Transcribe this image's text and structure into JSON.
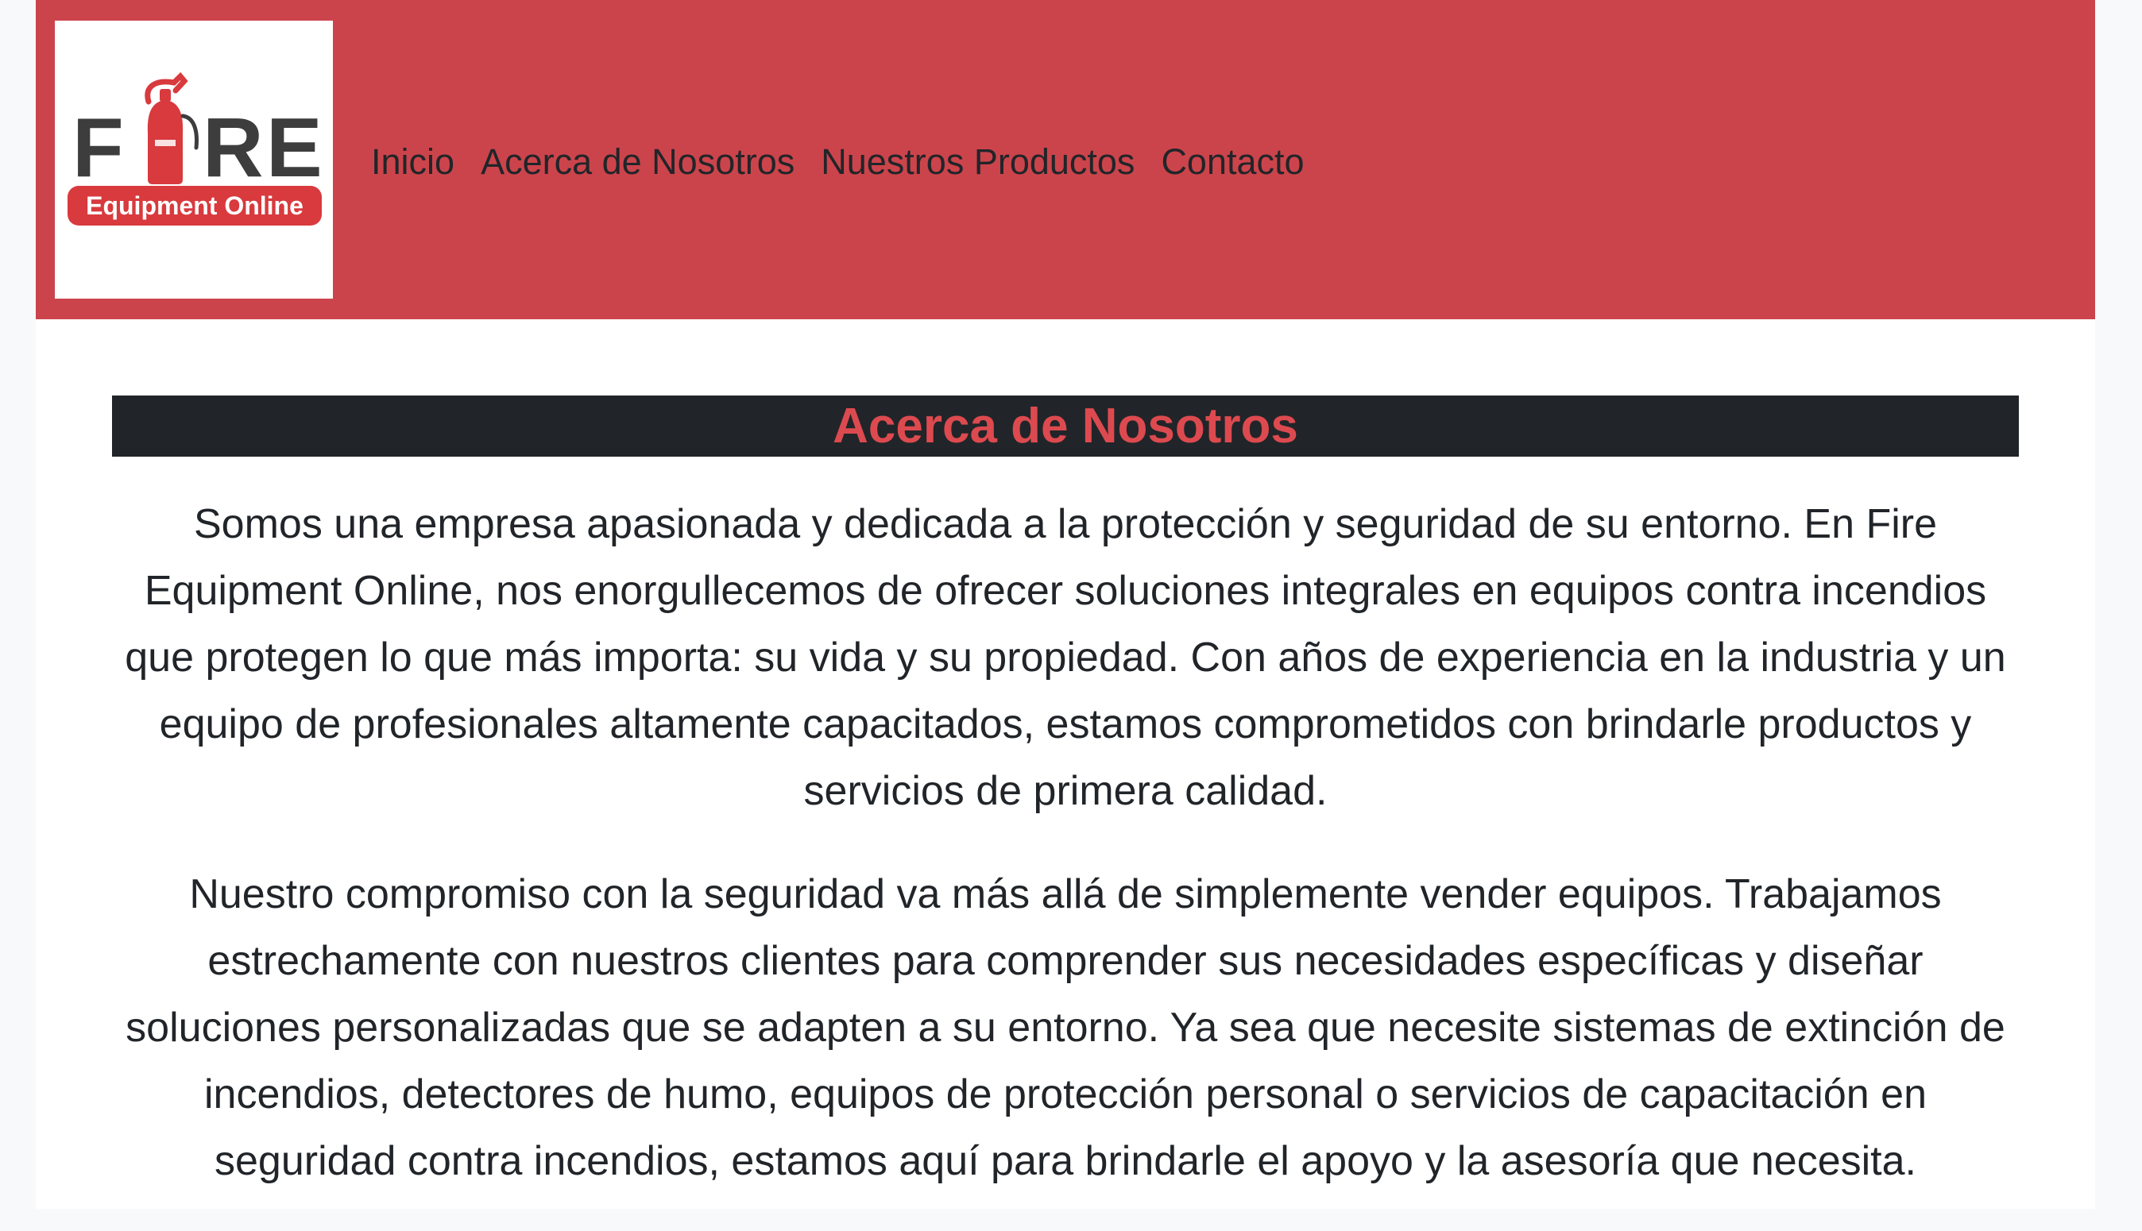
{
  "logo": {
    "word": "FIRE",
    "tagline": "Equipment Online"
  },
  "nav": {
    "items": [
      {
        "label": "Inicio"
      },
      {
        "label": "Acerca de Nosotros"
      },
      {
        "label": "Nuestros Productos"
      },
      {
        "label": "Contacto"
      }
    ]
  },
  "about": {
    "title": "Acerca de Nosotros",
    "paragraphs": [
      "Somos una empresa apasionada y dedicada a la protección y seguridad de su entorno. En Fire Equipment Online, nos enorgullecemos de ofrecer soluciones integrales en equipos contra incendios que protegen lo que más importa: su vida y su propiedad. Con años de experiencia en la industria y un equipo de profesionales altamente capacitados, estamos comprometidos con brindarle productos y servicios de primera calidad.",
      "Nuestro compromiso con la seguridad va más allá de simplemente vender equipos. Trabajamos estrechamente con nuestros clientes para comprender sus necesidades específicas y diseñar soluciones personalizadas que se adapten a su entorno. Ya sea que necesite sistemas de extinción de incendios, detectores de humo, equipos de protección personal o servicios de capacitación en seguridad contra incendios, estamos aquí para brindarle el apoyo y la asesoría que necesita."
    ]
  },
  "colors": {
    "navbar": "#cc444b",
    "heading_bar": "#212529",
    "heading_text": "#dc4a4f",
    "body_text": "#212529"
  }
}
